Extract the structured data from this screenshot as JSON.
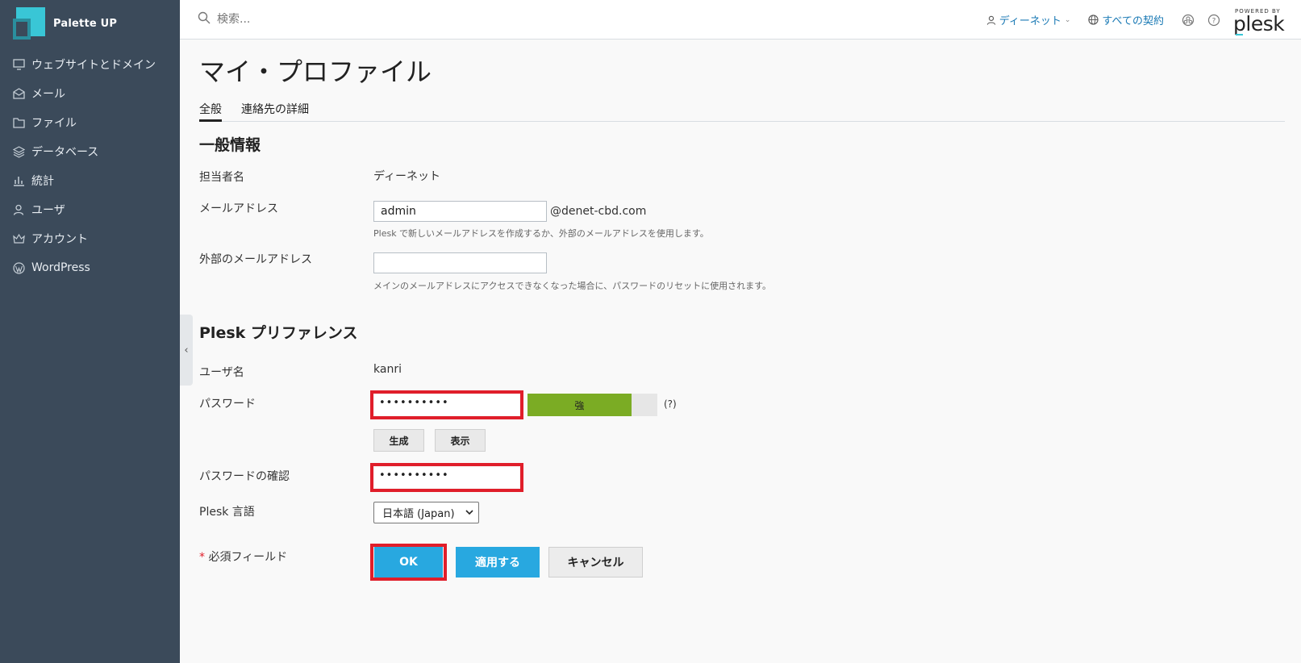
{
  "brand": {
    "name": "Palette UP"
  },
  "sidebar": {
    "items": [
      {
        "label": "ウェブサイトとドメイン",
        "icon": "monitor-icon"
      },
      {
        "label": "メール",
        "icon": "mail-icon"
      },
      {
        "label": "ファイル",
        "icon": "folder-icon"
      },
      {
        "label": "データベース",
        "icon": "database-layers-icon"
      },
      {
        "label": "統計",
        "icon": "bar-chart-icon"
      },
      {
        "label": "ユーザ",
        "icon": "user-icon"
      },
      {
        "label": "アカウント",
        "icon": "crown-icon"
      },
      {
        "label": "WordPress",
        "icon": "wordpress-icon"
      }
    ]
  },
  "topbar": {
    "search_placeholder": "検索...",
    "user_label": "ディーネット",
    "subscriptions_label": "すべての契約",
    "powered_by": "POWERED BY",
    "plesk": "plesk"
  },
  "page": {
    "title": "マイ・プロファイル",
    "tabs": [
      "全般",
      "連絡先の詳細"
    ],
    "general": {
      "title": "一般情報",
      "contact_name_label": "担当者名",
      "contact_name_value": "ディーネット",
      "email_label": "メールアドレス",
      "email_value": "admin",
      "email_domain": "@denet-cbd.com",
      "email_hint": "Plesk で新しいメールアドレスを作成するか、外部のメールアドレスを使用します。",
      "external_email_label": "外部のメールアドレス",
      "external_email_value": "",
      "external_email_hint": "メインのメールアドレスにアクセスできなくなった場合に、パスワードのリセットに使用されます。"
    },
    "preferences": {
      "title": "Plesk プリファレンス",
      "username_label": "ユーザ名",
      "username_value": "kanri",
      "password_label": "パスワード",
      "password_value": "••••••••••",
      "strength_label": "強",
      "strength_fraction": 0.8,
      "help_label": "(?)",
      "generate_label": "生成",
      "show_label": "表示",
      "confirm_label": "パスワードの確認",
      "confirm_value": "••••••••••",
      "language_label": "Plesk 言語",
      "language_value": "日本語 (Japan)"
    },
    "footer": {
      "required_star": "*",
      "required_label": "必須フィールド",
      "ok_label": "OK",
      "apply_label": "適用する",
      "cancel_label": "キャンセル"
    }
  },
  "colors": {
    "sidebar_bg": "#3b4a5a",
    "accent": "#28a8e0",
    "highlight": "#e01e2a",
    "strength_green": "#7bac24"
  }
}
